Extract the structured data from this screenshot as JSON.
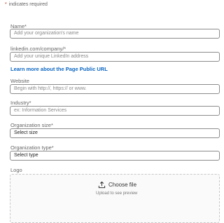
{
  "form": {
    "required_note": "indicates required",
    "required_star": "*",
    "name": {
      "label": "Name*",
      "placeholder": "Add your organization's name"
    },
    "linkedin": {
      "label": "linkedin.com/company/*",
      "placeholder": "Add your unique LinkedIn address"
    },
    "learn_more": "Learn more about the Page Public URL",
    "website": {
      "label": "Website",
      "placeholder": "Begin with http://, https:// or www."
    },
    "industry": {
      "label": "Industry*",
      "placeholder": "ex: Information Services"
    },
    "org_size": {
      "label": "Organization size*",
      "value": "Select size"
    },
    "org_type": {
      "label": "Organization type*",
      "value": "Select type"
    },
    "logo": {
      "label": "Logo",
      "choose_file": "Choose file",
      "hint": "Upload to see preview",
      "icon": "upload-icon"
    }
  },
  "colors": {
    "link": "#0a66c2",
    "required": "#b24020"
  }
}
